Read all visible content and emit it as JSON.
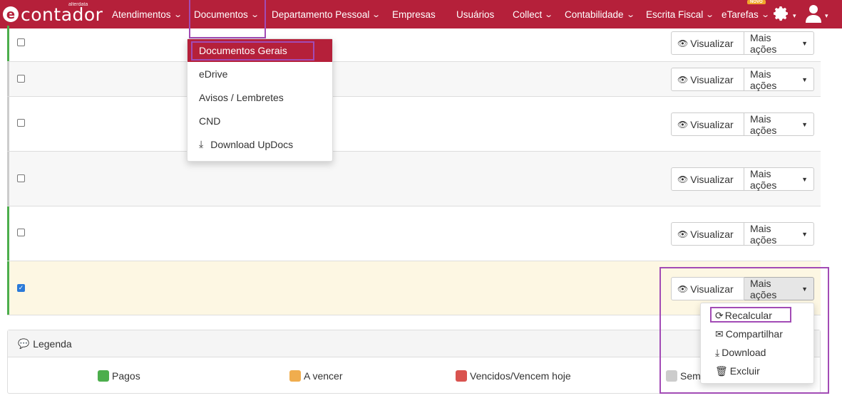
{
  "brand": {
    "small": "alterdata",
    "name": "contador"
  },
  "nav": [
    {
      "label": "Atendimentos",
      "chevron": true
    },
    {
      "label": "Documentos",
      "chevron": true
    },
    {
      "label": "Departamento Pessoal",
      "chevron": true
    },
    {
      "label": "Empresas",
      "chevron": false
    },
    {
      "label": "Usuários",
      "chevron": false
    },
    {
      "label": "Collect",
      "chevron": true
    },
    {
      "label": "Contabilidade",
      "chevron": true
    },
    {
      "label": "Escrita Fiscal",
      "chevron": true
    },
    {
      "label": "eTarefas",
      "chevron": true
    }
  ],
  "novo_badge": "NOVO",
  "documentos_menu": [
    "Documentos Gerais",
    "eDrive",
    "Avisos / Lembretes",
    "CND",
    "Download UpDocs"
  ],
  "row_actions": {
    "view": "Visualizar",
    "more": "Mais ações"
  },
  "more_actions_menu": [
    "Recalcular",
    "Compartilhar",
    "Download",
    "Excluir"
  ],
  "legend": {
    "title": "Legenda",
    "items": [
      {
        "label": "Pagos",
        "color": "#4cae4c"
      },
      {
        "label": "A vencer",
        "color": "#f0ad4e"
      },
      {
        "label": "Vencidos/Vencem hoje",
        "color": "#d9534f"
      },
      {
        "label": "Sem",
        "color": "#cccccc"
      }
    ]
  },
  "colors": {
    "brand": "#b5203a",
    "highlight": "#a24bb5",
    "selected_row": "#fdf7e3"
  }
}
